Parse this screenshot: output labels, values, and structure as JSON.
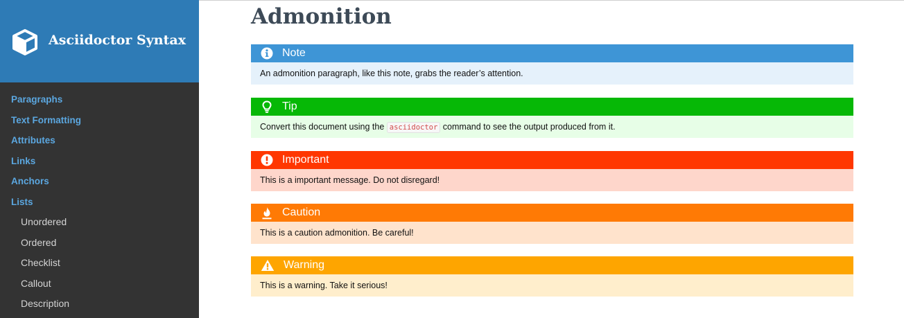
{
  "app": {
    "title": "Asciidoctor Syntax",
    "logo_icon": "cube-icon"
  },
  "sidebar": {
    "items": [
      {
        "label": "Paragraphs"
      },
      {
        "label": "Text Formatting"
      },
      {
        "label": "Attributes"
      },
      {
        "label": "Links"
      },
      {
        "label": "Anchors"
      },
      {
        "label": "Lists"
      }
    ],
    "subitems": [
      {
        "label": "Unordered"
      },
      {
        "label": "Ordered"
      },
      {
        "label": "Checklist"
      },
      {
        "label": "Callout"
      },
      {
        "label": "Description"
      }
    ]
  },
  "main": {
    "title": "Admonition",
    "admonitions": [
      {
        "type": "note",
        "label": "Note",
        "icon": "info-icon",
        "header_color": "#3e95d6",
        "body_color": "#e5f1fb",
        "text": "An admonition paragraph, like this note, grabs the reader’s attention."
      },
      {
        "type": "tip",
        "label": "Tip",
        "icon": "lightbulb-icon",
        "header_color": "#06b806",
        "body_color": "#e7fee7",
        "text_before": "Convert this document using the",
        "code": "asciidoctor",
        "text_after": "command to see the output produced from it."
      },
      {
        "type": "important",
        "label": "Important",
        "icon": "exclamation-circle-icon",
        "header_color": "#ff3700",
        "body_color": "#fed6cb",
        "text": "This is a important message. Do not disregard!"
      },
      {
        "type": "caution",
        "label": "Caution",
        "icon": "fire-icon",
        "header_color": "#ff7a05",
        "body_color": "#ffe3cc",
        "text": "This is a caution admonition. Be careful!"
      },
      {
        "type": "warning",
        "label": "Warning",
        "icon": "warning-triangle-icon",
        "header_color": "#fea500",
        "body_color": "#ffeecc",
        "text": "This is a warning. Take it serious!"
      }
    ]
  }
}
